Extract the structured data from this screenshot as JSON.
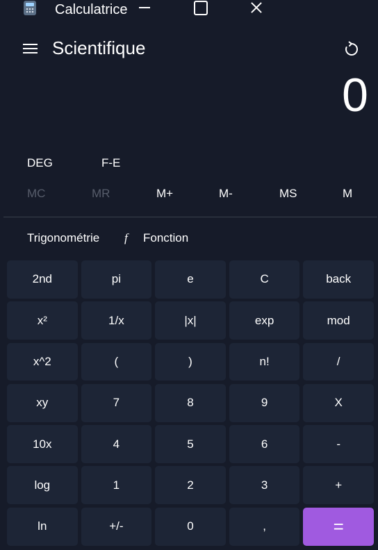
{
  "window": {
    "title": "Calculatrice"
  },
  "header": {
    "mode": "Scientifique"
  },
  "display": {
    "value": "0"
  },
  "options": {
    "angle": "DEG",
    "fe": "F-E"
  },
  "memory": [
    {
      "label": "MC",
      "enabled": false
    },
    {
      "label": "MR",
      "enabled": false
    },
    {
      "label": "M+",
      "enabled": true
    },
    {
      "label": "M-",
      "enabled": true
    },
    {
      "label": "MS",
      "enabled": true
    },
    {
      "label": "M",
      "enabled": true
    }
  ],
  "functions": {
    "trig": "Trigonométrie",
    "f_glyph": "f",
    "func": "Fonction"
  },
  "keys": [
    "2nd",
    "pi",
    "e",
    "C",
    "back",
    "x²",
    "1/x",
    "|x|",
    "exp",
    "mod",
    "x^2",
    "(",
    ")",
    "n!",
    "/",
    "xy",
    "7",
    "8",
    "9",
    "X",
    "10x",
    "4",
    "5",
    "6",
    "-",
    "log",
    "1",
    "2",
    "3",
    "+",
    "ln",
    "+/-",
    "0",
    ",",
    "="
  ],
  "colors": {
    "background": "#161b29",
    "key": "#1d2536",
    "equals": "#a05ae0",
    "disabled_text": "#575d6b"
  }
}
